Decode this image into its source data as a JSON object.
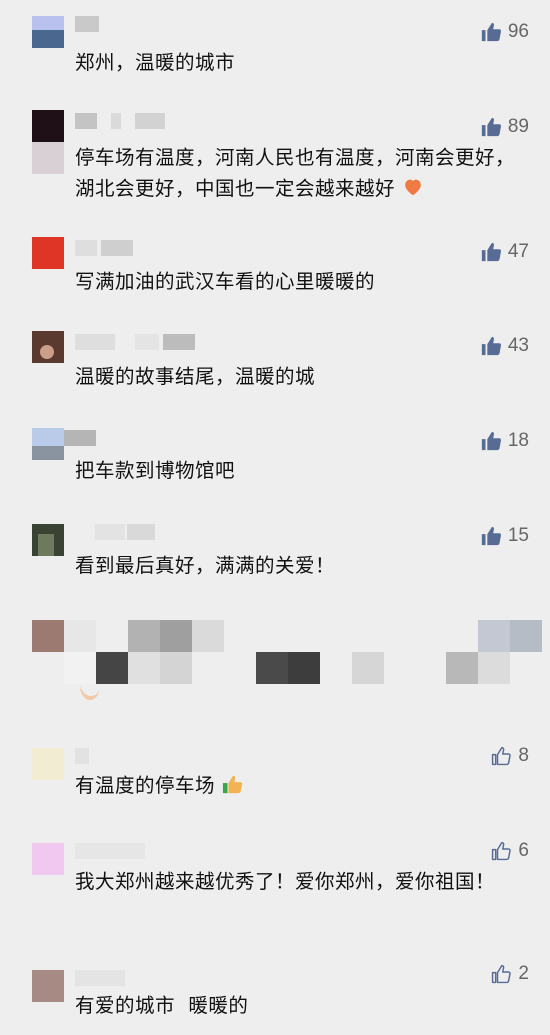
{
  "colors": {
    "thumb_filled": "#576b95",
    "thumb_outline": "#576b95",
    "count": "#666666",
    "background": "#eeeeee"
  },
  "comments": [
    {
      "text": "郑州，温暖的城市",
      "likes": "96",
      "liked": true
    },
    {
      "text": "停车场有温度，河南人民也有温度，河南会更好，湖北会更好，中国也一定会越来越好",
      "emoji": "heart-emoji",
      "likes": "89",
      "liked": true
    },
    {
      "text": "写满加油的武汉车看的心里暖暖的",
      "likes": "47",
      "liked": true
    },
    {
      "text": "温暖的故事结尾，温暖的城",
      "likes": "43",
      "liked": true
    },
    {
      "text": "把车款到博物馆吧",
      "likes": "18",
      "liked": true
    },
    {
      "text": "看到最后真好，满满的关爱！",
      "likes": "15",
      "liked": true
    },
    {
      "text": "",
      "obscured": true
    },
    {
      "text": "有温度的停车场",
      "emoji": "thumbs-up-emoji",
      "likes": "8",
      "liked": false
    },
    {
      "text": "我大郑州越来越优秀了！爱你郑州，爱你祖国！",
      "likes": "6",
      "liked": false
    },
    {
      "text": "有爱的城市  暖暖的",
      "likes": "2",
      "liked": false
    }
  ]
}
